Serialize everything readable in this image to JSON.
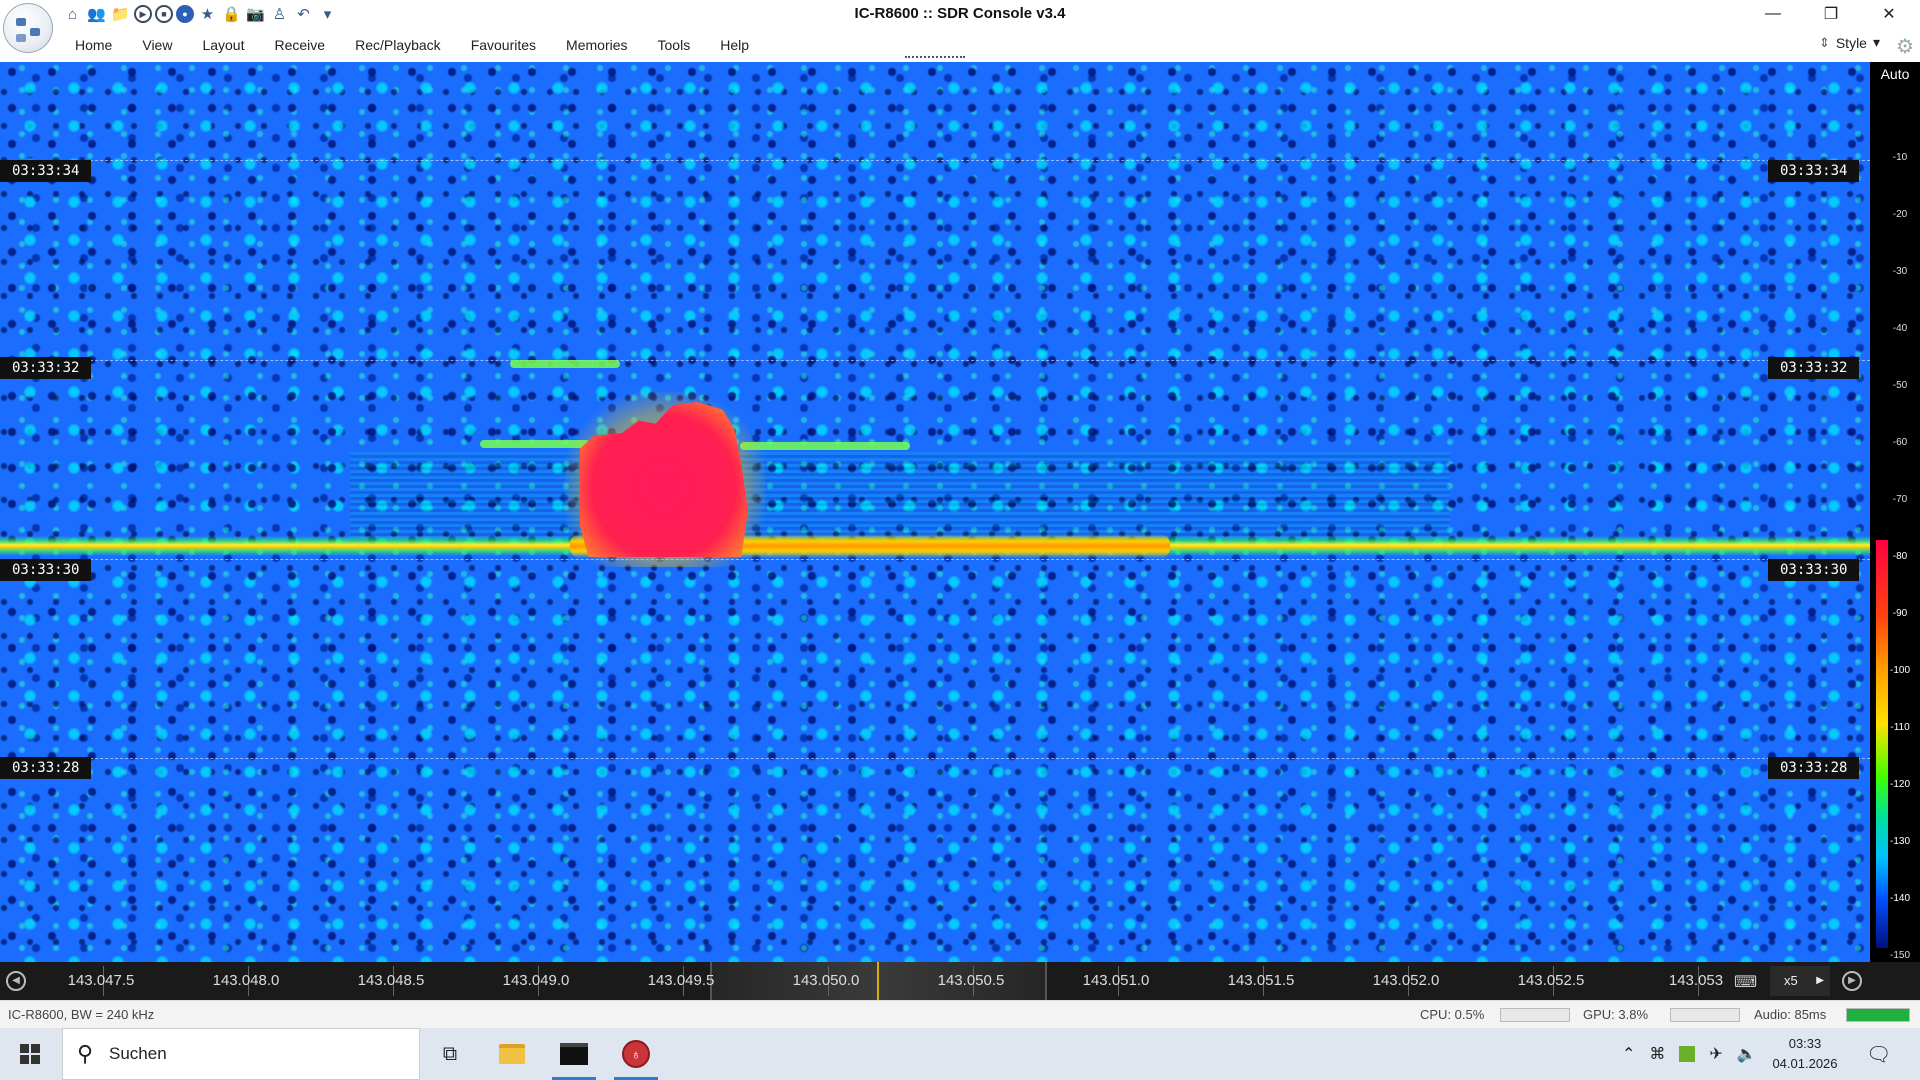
{
  "window": {
    "title": "IC-R8600 :: SDR Console v3.4",
    "controls": {
      "minimize": "—",
      "maximize": "❐",
      "close": "✕"
    }
  },
  "quick_access": [
    {
      "name": "home-icon",
      "glyph": "⌂"
    },
    {
      "name": "users-icon",
      "glyph": "👥"
    },
    {
      "name": "folder-icon",
      "glyph": "📁"
    },
    {
      "name": "play-icon",
      "glyph": "▶"
    },
    {
      "name": "stop-icon",
      "glyph": "■"
    },
    {
      "name": "record-icon",
      "glyph": "●"
    },
    {
      "name": "star-icon",
      "glyph": "★"
    },
    {
      "name": "lock-icon",
      "glyph": "🔒"
    },
    {
      "name": "camera-icon",
      "glyph": "📷"
    },
    {
      "name": "antenna-icon",
      "glyph": "♙"
    },
    {
      "name": "undo-icon",
      "glyph": "↶"
    },
    {
      "name": "customize-icon",
      "glyph": "▾"
    }
  ],
  "menu": [
    "Home",
    "View",
    "Layout",
    "Receive",
    "Rec/Playback",
    "Favourites",
    "Memories",
    "Tools",
    "Help"
  ],
  "style_menu": {
    "label": "Style",
    "arrow": "▾"
  },
  "waterfall": {
    "timestamps": [
      "03:33:34",
      "03:33:32",
      "03:33:30",
      "03:33:28"
    ]
  },
  "db_scale": {
    "auto_label": "Auto",
    "ticks": [
      "-10",
      "-20",
      "-30",
      "-40",
      "-50",
      "-60",
      "-70",
      "-80",
      "-90",
      "-100",
      "-110",
      "-120",
      "-130",
      "-140",
      "-150"
    ]
  },
  "frequency_axis": {
    "labels": [
      "143.047.5",
      "143.048.0",
      "143.048.5",
      "143.049.0",
      "143.049.5",
      "143.050.0",
      "143.050.5",
      "143.051.0",
      "143.051.5",
      "143.052.0",
      "143.052.5",
      "143.053"
    ],
    "zoom": "x5"
  },
  "status": {
    "device": "IC-R8600, BW = 240 kHz",
    "cpu": "CPU: 0.5%",
    "gpu": "GPU: 3.8%",
    "audio": "Audio: 85ms",
    "audio_level_fraction": 1.0
  },
  "taskbar": {
    "search_placeholder": "Suchen",
    "time": "03:33",
    "date": "04.01.2026"
  }
}
